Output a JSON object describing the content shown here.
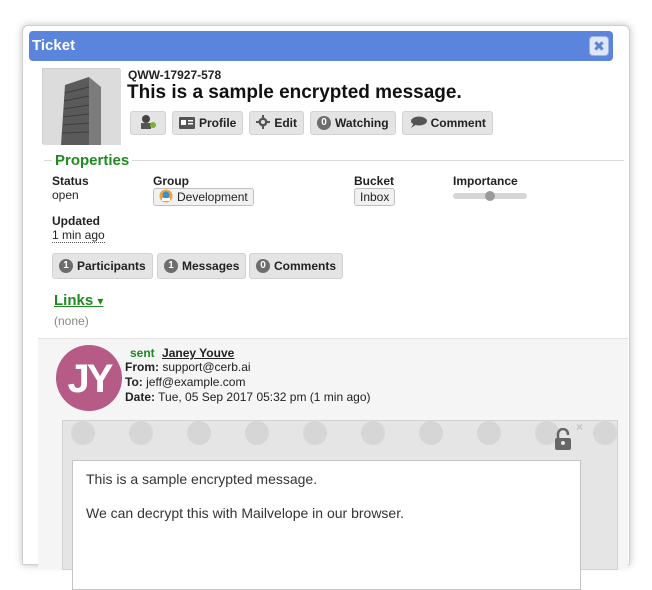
{
  "window": {
    "title": "Ticket",
    "close_glyph": "✖"
  },
  "ticket": {
    "mask": "QWW-17927-578",
    "subject": "This is a sample encrypted message."
  },
  "toolbar": {
    "profile_label": "Profile",
    "edit_label": "Edit",
    "watching_count": "0",
    "watching_label": "Watching",
    "comment_label": "Comment"
  },
  "properties": {
    "legend": "Properties",
    "status_label": "Status",
    "status_value": "open",
    "group_label": "Group",
    "group_value": "Development",
    "bucket_label": "Bucket",
    "bucket_value": "Inbox",
    "importance_label": "Importance",
    "importance_value": 0.5,
    "updated_label": "Updated",
    "updated_value": "1 min ago"
  },
  "counts": {
    "participants_count": "1",
    "participants_label": "Participants",
    "messages_count": "1",
    "messages_label": "Messages",
    "comments_count": "0",
    "comments_label": "Comments"
  },
  "links": {
    "label": "Links",
    "caret": "▾",
    "empty": "(none)"
  },
  "message": {
    "avatar_initials": "JY",
    "sent_verb": "sent",
    "sender_name": "Janey Youve",
    "from_label": "From:",
    "from_value": "support@cerb.ai",
    "to_label": "To:",
    "to_value": "jeff@example.com",
    "date_label": "Date:",
    "date_value": "Tue, 05 Sep 2017 05:32 pm (1 min ago)",
    "body_line1": "This is a sample encrypted message.",
    "body_line2": "We can decrypt this with Mailvelope in our browser.",
    "lock_close_glyph": "×"
  },
  "colors": {
    "titlebar": "#5b84dd",
    "accent_green": "#1f8a1f",
    "avatar_bg": "#b55b86"
  },
  "icons": [
    "close-icon",
    "building-icon",
    "bot-icon",
    "profile-card-icon",
    "gear-icon",
    "comment-bubble-icon",
    "group-icon",
    "caret-down-icon",
    "lock-icon"
  ]
}
